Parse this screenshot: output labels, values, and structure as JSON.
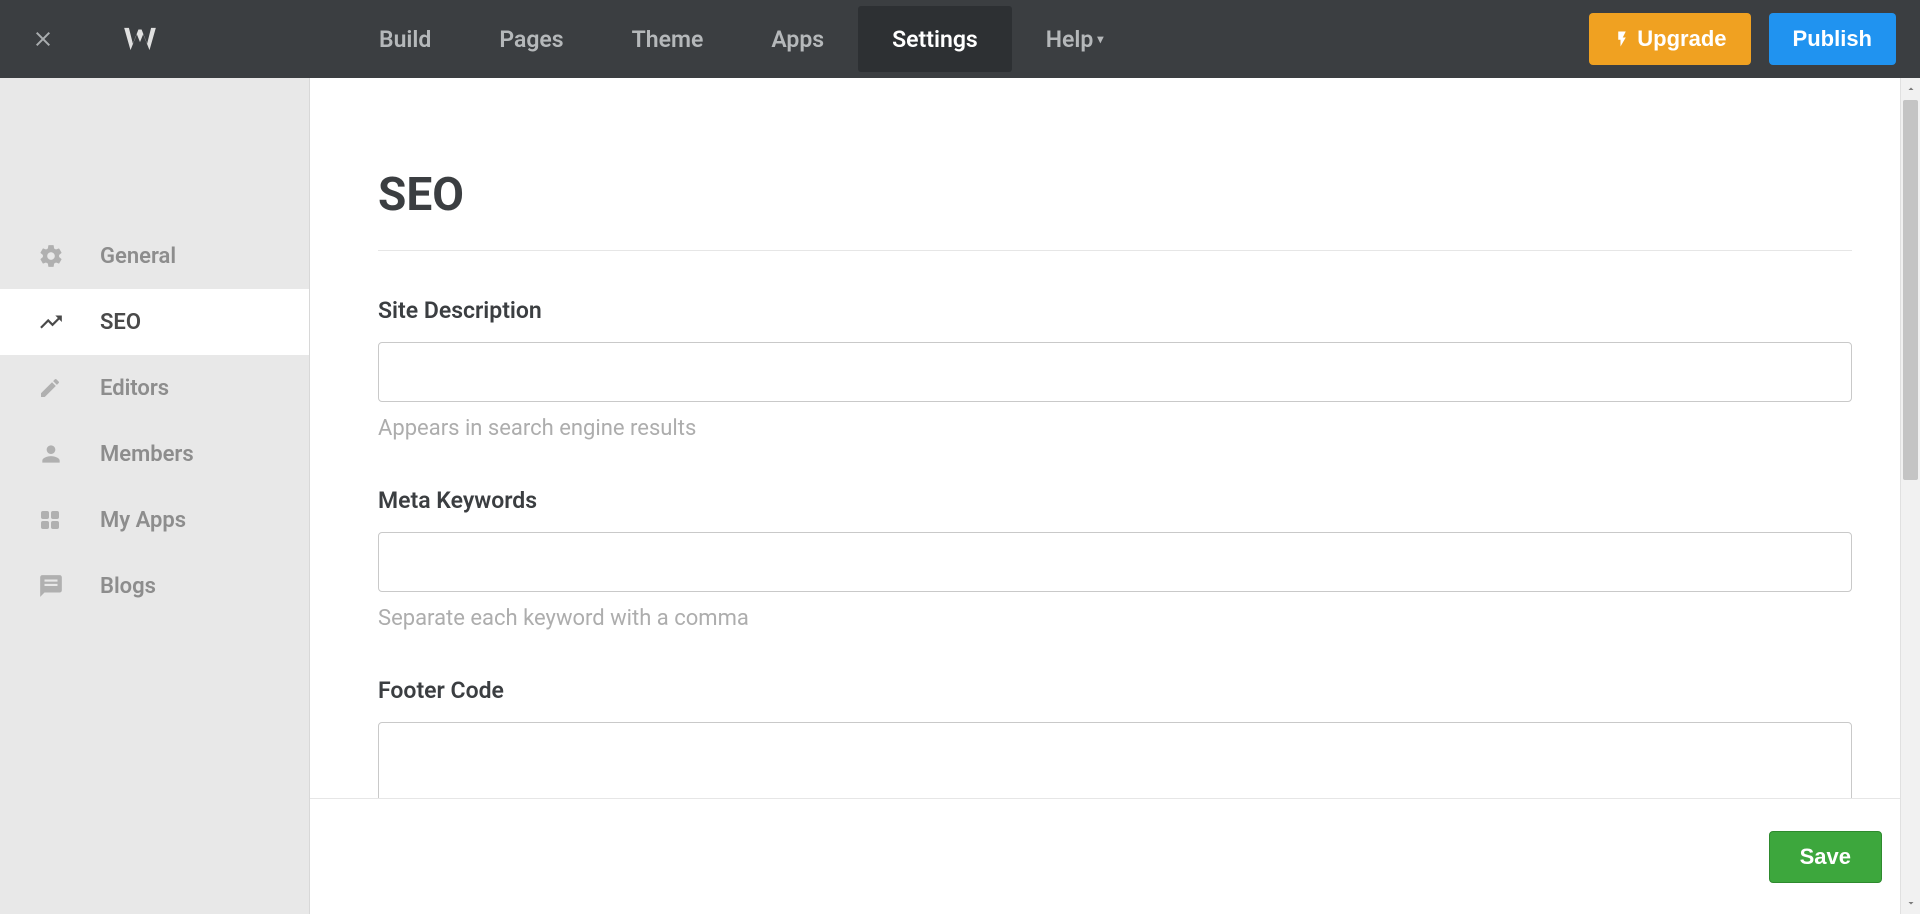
{
  "topnav": {
    "items": [
      {
        "label": "Build"
      },
      {
        "label": "Pages"
      },
      {
        "label": "Theme"
      },
      {
        "label": "Apps"
      },
      {
        "label": "Settings"
      },
      {
        "label": "Help"
      }
    ]
  },
  "actions": {
    "upgrade": "Upgrade",
    "publish": "Publish"
  },
  "sidebar": {
    "items": [
      {
        "label": "General"
      },
      {
        "label": "SEO"
      },
      {
        "label": "Editors"
      },
      {
        "label": "Members"
      },
      {
        "label": "My Apps"
      },
      {
        "label": "Blogs"
      }
    ]
  },
  "main": {
    "title": "SEO",
    "fields": {
      "site_description": {
        "label": "Site Description",
        "value": "",
        "help": "Appears in search engine results"
      },
      "meta_keywords": {
        "label": "Meta Keywords",
        "value": "",
        "help": "Separate each keyword with a comma"
      },
      "footer_code": {
        "label": "Footer Code",
        "value": ""
      }
    },
    "save": "Save"
  }
}
